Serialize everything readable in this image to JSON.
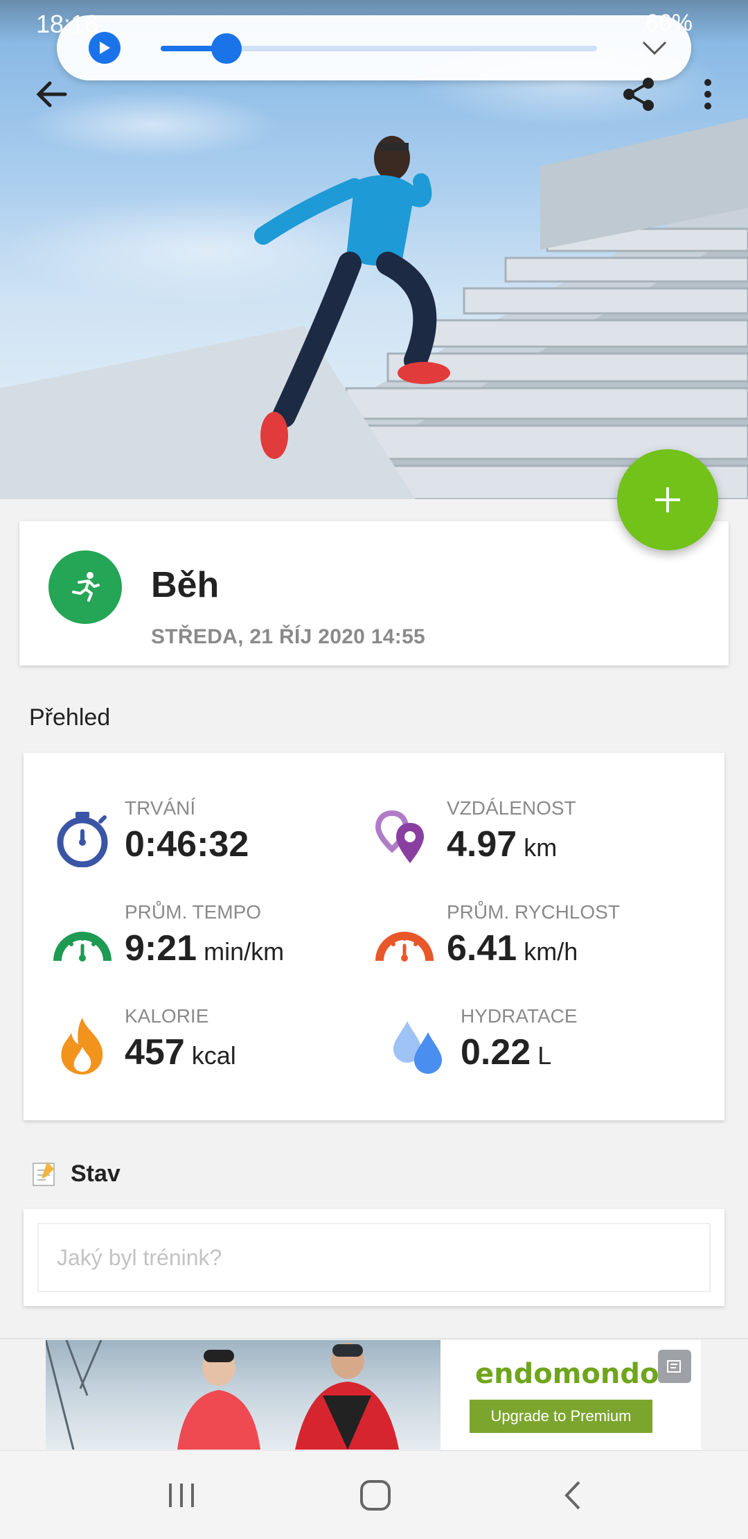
{
  "status_bar": {
    "time": "18:16",
    "battery": "66%"
  },
  "media_player": {
    "progress_percent": 15
  },
  "activity": {
    "title": "Běh",
    "date": "STŘEDA, 21 ŘÍJ 2020 14:55"
  },
  "overview": {
    "title": "Přehled",
    "stats": [
      {
        "label": "TRVÁNÍ",
        "value": "0:46:32",
        "unit": "",
        "icon": "stopwatch-icon",
        "color": "#3b55a6"
      },
      {
        "label": "VZDÁLENOST",
        "value": "4.97",
        "unit": "km",
        "icon": "location-pins-icon",
        "color": "#8a3fa0"
      },
      {
        "label": "PRŮM. TEMPO",
        "value": "9:21",
        "unit": "min/km",
        "icon": "pace-gauge-icon",
        "color": "#1e9a52"
      },
      {
        "label": "PRŮM. RYCHLOST",
        "value": "6.41",
        "unit": "km/h",
        "icon": "speed-gauge-icon",
        "color": "#e8572a"
      },
      {
        "label": "KALORIE",
        "value": "457",
        "unit": "kcal",
        "icon": "flame-icon",
        "color": "#f2931e"
      },
      {
        "label": "HYDRATACE",
        "value": "0.22",
        "unit": "L",
        "icon": "water-drops-icon",
        "color": "#4a8ef0"
      }
    ]
  },
  "status_section": {
    "title": "Stav",
    "placeholder": "Jaký byl trénink?"
  },
  "ad": {
    "brand": "endomondo",
    "button": "Upgrade to Premium"
  },
  "colors": {
    "accent_green": "#72c21a",
    "activity_green": "#25a556",
    "media_blue": "#1a73e8"
  }
}
